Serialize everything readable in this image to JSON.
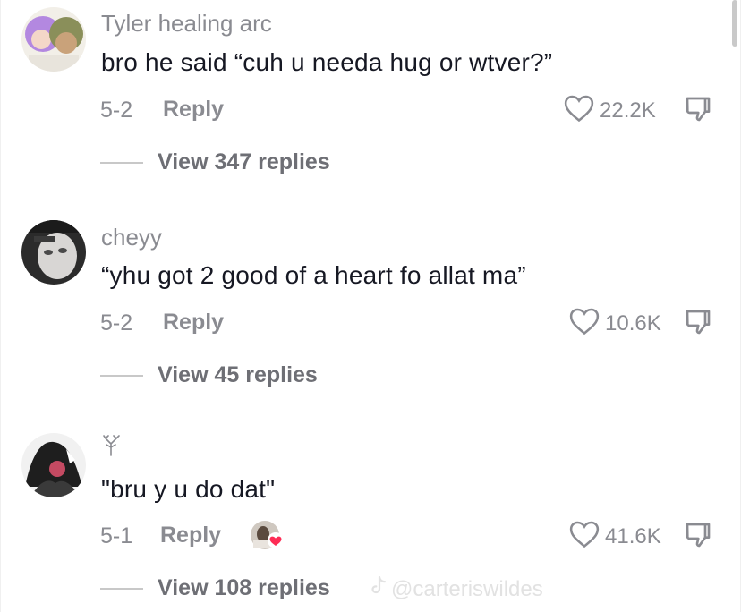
{
  "comments": [
    {
      "username": "Tyler healing arc",
      "text": "bro he said “cuh u needa hug or wtver?”",
      "date": "5-2",
      "reply_label": "Reply",
      "likes": "22.2K",
      "view_replies": "View 347 replies"
    },
    {
      "username": "cheyy",
      "text": "“yhu got 2 good of a heart fo allat ma”",
      "date": "5-2",
      "reply_label": "Reply",
      "likes": "10.6K",
      "view_replies": "View 45 replies"
    },
    {
      "username": "",
      "text": "\"bru y u do dat\"",
      "date": "5-1",
      "reply_label": "Reply",
      "likes": "41.6K",
      "view_replies": "View 108 replies"
    }
  ],
  "watermark": "@carteriswildes",
  "colors": {
    "text": "#161823",
    "muted": "#8a8b91",
    "heart_badge": "#fe2c55"
  },
  "icons": [
    "heart-outline-icon",
    "thumbs-down-icon",
    "tree-glyph-icon",
    "tiktok-logo-icon"
  ]
}
